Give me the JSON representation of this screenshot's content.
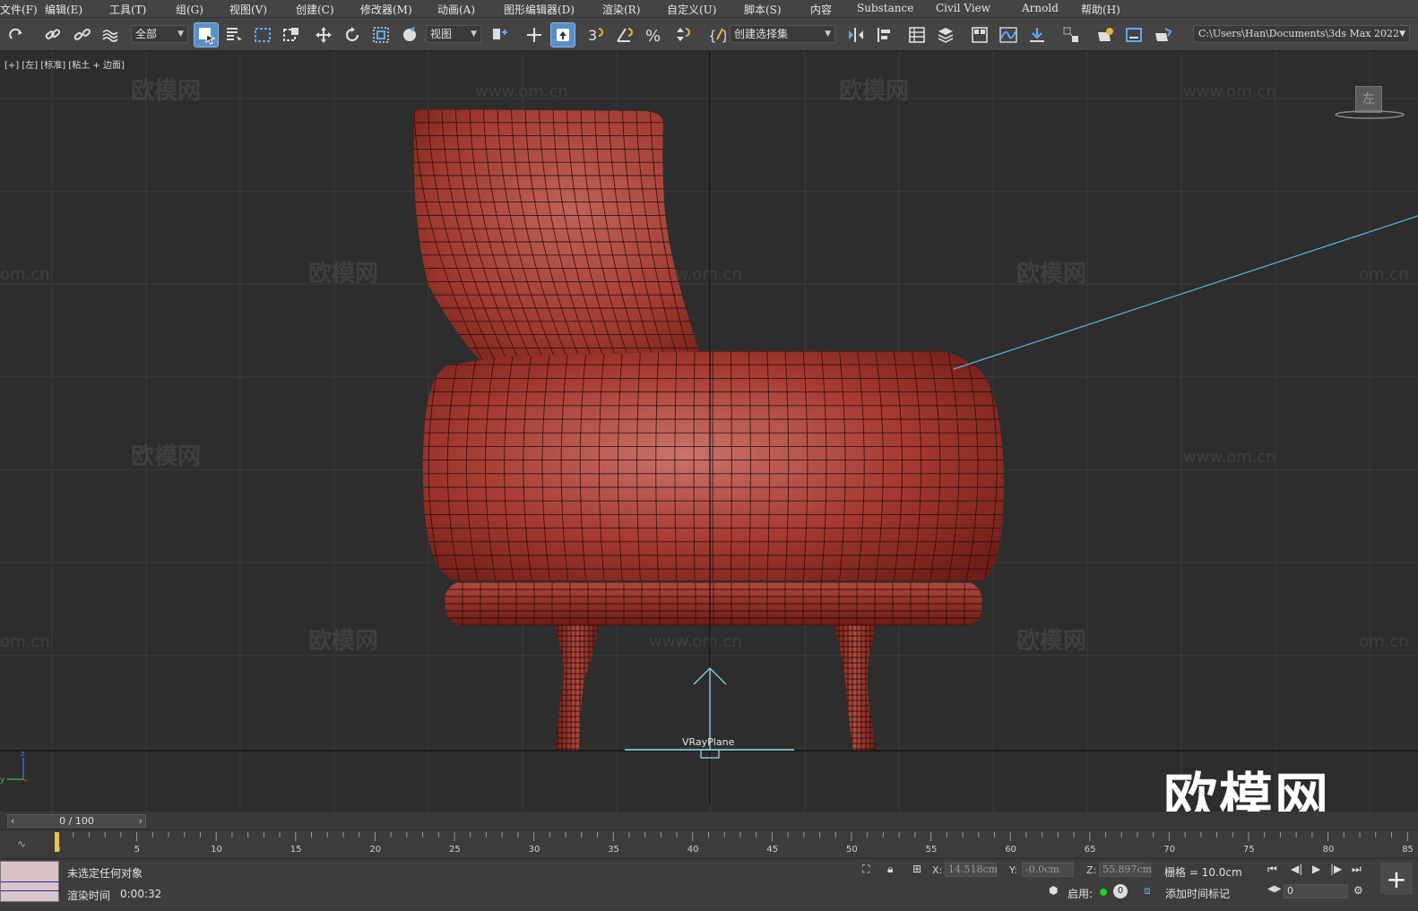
{
  "menu": {
    "items": [
      "文件(F)",
      "编辑(E)",
      "工具(T)",
      "组(G)",
      "视图(V)",
      "创建(C)",
      "修改器(M)",
      "动画(A)",
      "图形编辑器(D)",
      "渲染(R)",
      "自定义(U)",
      "脚本(S)",
      "内容",
      "Substance",
      "Civil View",
      "Arnold",
      "帮助(H)"
    ]
  },
  "toolbar": {
    "selection_filter": "全部",
    "ref_coord": "视图",
    "named_selection": "创建选择集",
    "project_path": "C:\\Users\\Han\\Documents\\3ds Max 2022",
    "snap_value": "3"
  },
  "viewport": {
    "label": "[+] [左] [标准] [粘土 + 边面]",
    "object_label": "VRayPlane",
    "viewcube_face": "左",
    "watermark_cn": "欧模网",
    "watermark_url": "www.om.cn",
    "logo_text": "欧模网",
    "mesh_color": "#a63a30"
  },
  "timeline": {
    "frame_display": "0 / 100",
    "ticks": [
      "0",
      "5",
      "10",
      "15",
      "20",
      "25",
      "30",
      "35",
      "40",
      "45",
      "50",
      "55",
      "60",
      "65",
      "70",
      "75",
      "80",
      "85"
    ]
  },
  "status": {
    "selection_text": "未选定任何对象",
    "render_label": "渲染时间",
    "render_time": "0:00:32",
    "x_label": "X:",
    "x_value": "14.518cm",
    "y_label": "Y:",
    "y_value": "-0.0cm",
    "z_label": "Z:",
    "z_value": "55.897cm",
    "grid": "栅格 = 10.0cm",
    "enable_label": "启用:",
    "enable_count": "0",
    "add_time_tag": "添加时间标记",
    "current_frame": "0"
  }
}
